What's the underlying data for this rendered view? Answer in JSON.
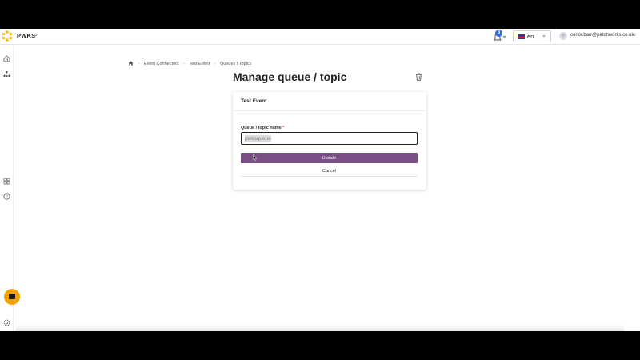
{
  "header": {
    "org_name": "PWKS",
    "notification_count": "3",
    "language": "en",
    "user_email": "conor.barr@patchworks.co.uk"
  },
  "breadcrumb": {
    "items": [
      "Event Connectors",
      "Test Event",
      "Queues / Topics"
    ]
  },
  "page": {
    "title": "Manage queue / topic"
  },
  "card": {
    "title": "Test Event",
    "field_label": "Queue / topic name",
    "required_mark": "*",
    "field_value": "pwksqueue",
    "update_label": "Update",
    "cancel_label": "Cancel"
  },
  "colors": {
    "primary_button": "#7a4f86",
    "badge": "#2d6be0",
    "chat_bubble": "#f2a300",
    "logo": "#f4c20d"
  }
}
